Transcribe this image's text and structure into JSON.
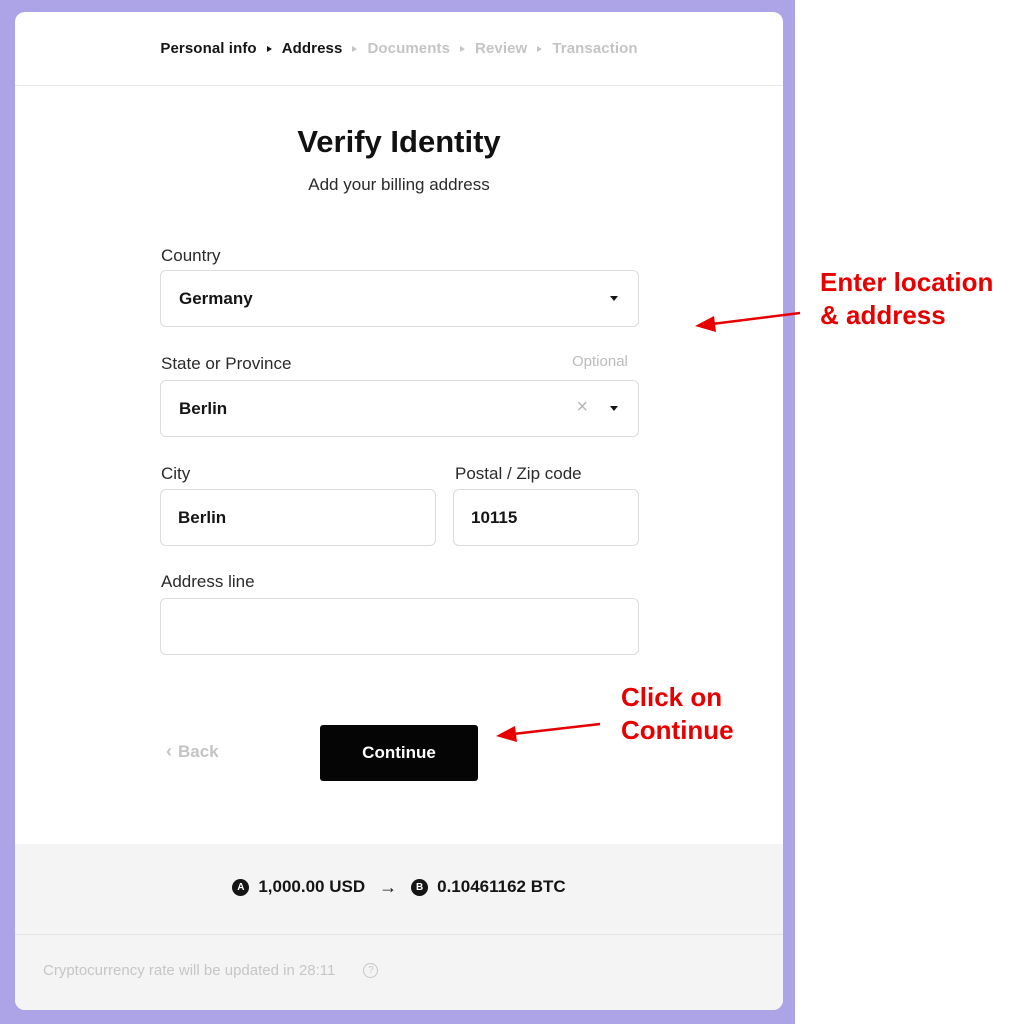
{
  "steps": [
    {
      "label": "Personal info",
      "done": true
    },
    {
      "label": "Address",
      "done": true
    },
    {
      "label": "Documents",
      "done": false
    },
    {
      "label": "Review",
      "done": false
    },
    {
      "label": "Transaction",
      "done": false
    }
  ],
  "heading": {
    "title": "Verify Identity",
    "subtitle": "Add your billing address"
  },
  "form": {
    "country": {
      "label": "Country",
      "value": "Germany"
    },
    "state": {
      "label": "State or Province",
      "optional": "Optional",
      "value": "Berlin",
      "clear": "×"
    },
    "city": {
      "label": "City",
      "value": "Berlin"
    },
    "postal": {
      "label": "Postal / Zip code",
      "value": "10115"
    },
    "address": {
      "label": "Address line",
      "value": ""
    }
  },
  "actions": {
    "back": "Back",
    "back_chevron": "‹",
    "continue": "Continue"
  },
  "conversion": {
    "from": "1,000.00 USD",
    "to": "0.10461162 BTC",
    "arrow": "→",
    "from_coin": "A",
    "to_coin": "B"
  },
  "footer": {
    "rate_notice": "Cryptocurrency rate will be updated in 28:11",
    "help": "?"
  },
  "annotations": {
    "location": [
      "Enter location",
      "& address"
    ],
    "continue": [
      "Click on",
      "Continue"
    ]
  },
  "colors": {
    "frame": "#ada4e8",
    "annotation": "#e60000",
    "button": "#050505"
  }
}
